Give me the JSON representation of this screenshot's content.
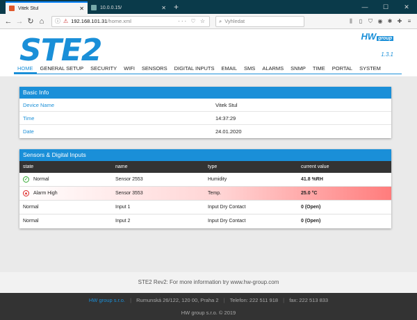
{
  "browser": {
    "tabs": [
      {
        "label": "Vitek Stul",
        "close": "✕"
      },
      {
        "label": "10.0.0.15/",
        "close": "✕"
      }
    ],
    "new_tab": "+",
    "window_controls": {
      "minimize": "—",
      "maximize": "☐",
      "close": "✕"
    },
    "url_host": "192.168.101.31",
    "url_path": "/home.xml",
    "url_actions": "··· ♡ ☆",
    "search_placeholder": "Vyhledat",
    "toolbar_icons": [
      "library-icon",
      "sidebar-icon",
      "shield-icon",
      "extension-icon",
      "puzzle-icon",
      "tools-icon",
      "menu-icon"
    ]
  },
  "header": {
    "logo": "STE2",
    "brand": "HW",
    "brand_sub": "group",
    "version": "1.3.1"
  },
  "menu": {
    "items": [
      "HOME",
      "GENERAL SETUP",
      "SECURITY",
      "WIFI",
      "SENSORS",
      "DIGITAL INPUTS",
      "EMAIL",
      "SMS",
      "ALARMS",
      "SNMP",
      "TIME",
      "PORTAL",
      "SYSTEM"
    ],
    "active_index": 0
  },
  "basic_info": {
    "title": "Basic Info",
    "rows": [
      {
        "label": "Device Name",
        "value": "Vitek Stul"
      },
      {
        "label": "Time",
        "value": "14:37:29"
      },
      {
        "label": "Date",
        "value": "24.01.2020"
      }
    ]
  },
  "sensors": {
    "title": "Sensors & Digital Inputs",
    "columns": [
      "state",
      "name",
      "type",
      "current value"
    ],
    "rows": [
      {
        "state": "Normal",
        "name": "Sensor 2553",
        "type": "Humidity",
        "value": "41.8 %RH",
        "icon": "check-icon"
      },
      {
        "state": "Alarm High",
        "name": "Sensor 3553",
        "type": "Temp.",
        "value": "25.0 °C",
        "icon": "alarm-icon"
      },
      {
        "state": "Normal",
        "name": "Input 1",
        "type": "Input Dry Contact",
        "value": "0 (Open)"
      },
      {
        "state": "Normal",
        "name": "Input 2",
        "type": "Input Dry Contact",
        "value": "0 (Open)"
      }
    ]
  },
  "footer": {
    "info": "STE2 Rev2: For more information try www.hw-group.com",
    "company_link": "HW group s.r.o.",
    "address": "Rumunská 26/122, 120 00, Praha 2",
    "phone": "Telefon: 222 511 918",
    "fax": "fax: 222 513 833",
    "copyright": "HW group s.r.o. © 2019"
  },
  "colors": {
    "accent": "#1a8fd8",
    "alarm": "#ff7c7c",
    "header_dark": "#333333"
  }
}
